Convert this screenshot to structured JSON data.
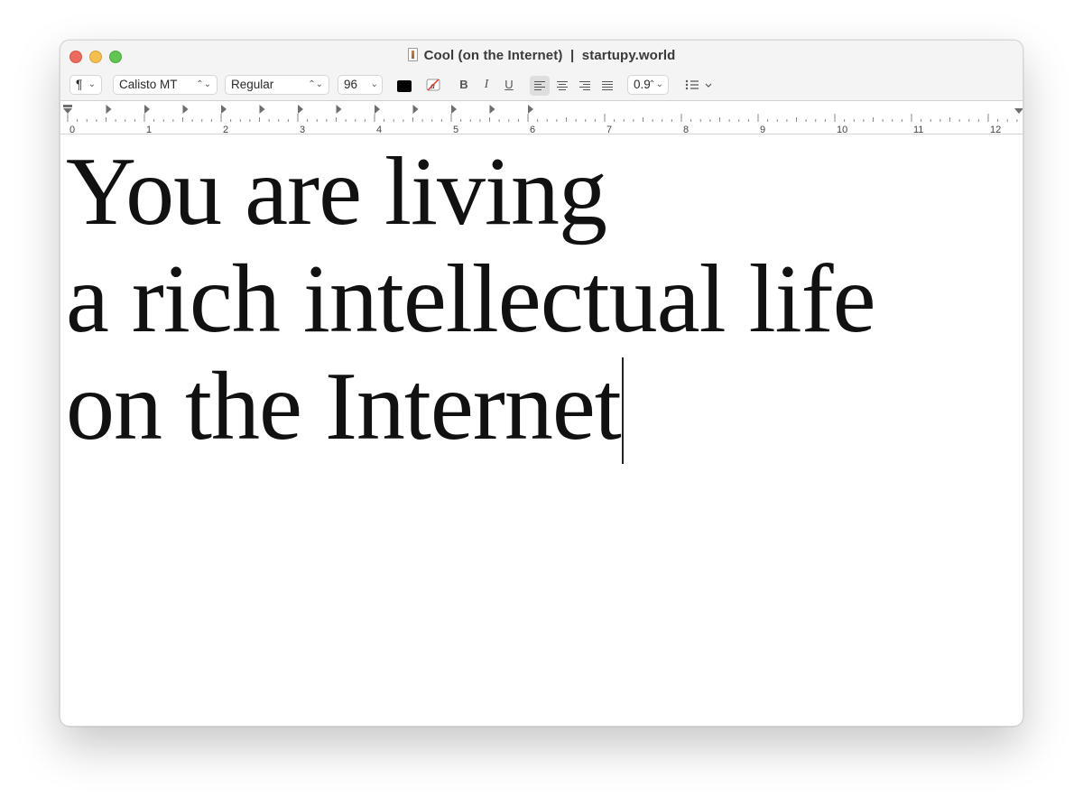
{
  "window": {
    "title": "Cool (on the Internet)  |  startupy.world"
  },
  "toolbar": {
    "paragraph_style": "¶",
    "font_family": "Calisto MT",
    "font_style": "Regular",
    "font_size": "96",
    "text_color": "#000000",
    "bold_label": "B",
    "italic_label": "I",
    "underline_label": "U",
    "line_spacing": "0.9",
    "alignment_selected": "left"
  },
  "ruler": {
    "labels": [
      "0",
      "1",
      "2",
      "3",
      "4",
      "5",
      "6",
      "7",
      "8",
      "9",
      "10",
      "11",
      "12"
    ]
  },
  "document": {
    "lines": [
      "You are living",
      "a rich intellectual life",
      "on the Internet"
    ]
  }
}
